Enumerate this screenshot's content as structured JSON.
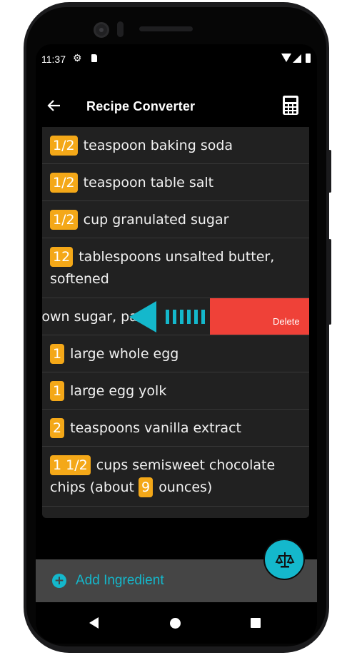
{
  "status_bar": {
    "time": "11:37"
  },
  "app_bar": {
    "title": "Recipe Converter",
    "back_icon": "arrow-left-icon",
    "action_icon": "calculator-icon"
  },
  "ingredients": [
    {
      "qty": "1/2",
      "text": "teaspoon baking soda"
    },
    {
      "qty": "1/2",
      "text": "teaspoon table salt"
    },
    {
      "qty": "1/2",
      "text": "cup granulated sugar"
    },
    {
      "qty": "12",
      "text": "tablespoons unsalted butter, softened"
    },
    {
      "text": "rown sugar, pa",
      "delete_label": "Delete",
      "swiping": true
    },
    {
      "qty": "1",
      "text": "large whole egg"
    },
    {
      "qty": "1",
      "text": "large egg yolk"
    },
    {
      "qty": "2",
      "text": "teaspoons vanilla extract"
    },
    {
      "qty": "1 1/2",
      "text": "cups semisweet chocolate chips (about",
      "qty2": "9",
      "text2": "ounces)"
    }
  ],
  "bottom_panel": {
    "add_label": "Add Ingredient"
  },
  "fab": {
    "icon": "scale-icon"
  },
  "colors": {
    "accent": "#14b8cc",
    "badge": "#f4a818",
    "delete": "#ef4138",
    "card": "#212121"
  }
}
